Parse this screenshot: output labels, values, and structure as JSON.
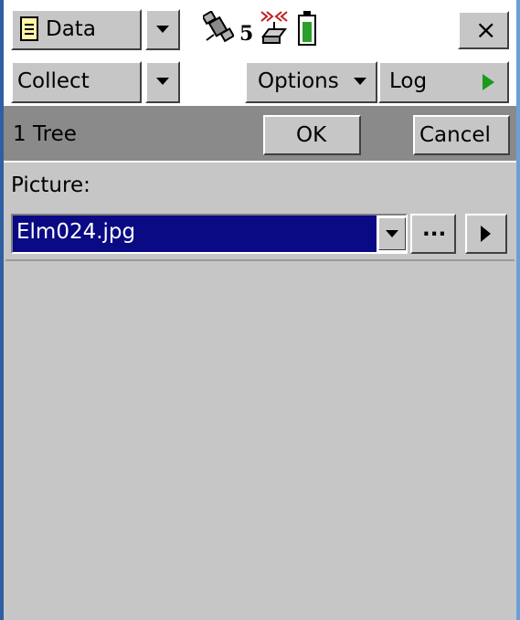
{
  "title_bar": {
    "data_label": "Data",
    "satellite_count": "5",
    "close_glyph": "×"
  },
  "toolbar": {
    "collect_label": "Collect",
    "options_label": "Options",
    "log_label": "Log"
  },
  "form_header": {
    "feature_label": "1 Tree",
    "ok_label": "OK",
    "cancel_label": "Cancel"
  },
  "picture_field": {
    "label": "Picture:",
    "value": "Elm024.jpg",
    "browse_label": "..."
  },
  "colors": {
    "selection": "#0a0a84",
    "log_play": "#1a9a1a",
    "header_bar": "#8a8a8a",
    "battery_fill": "#2aa02a"
  }
}
